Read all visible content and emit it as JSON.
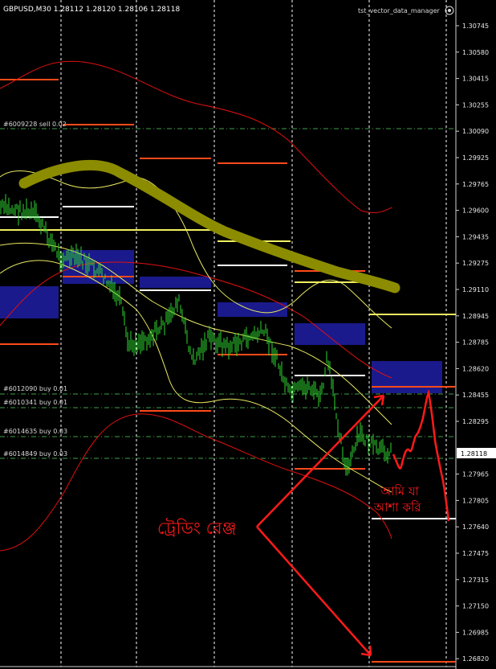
{
  "header": {
    "symbol_info": "GBPUSD,M30  1.28112 1.28120 1.28106 1.28118",
    "indicator_name": "tst_vector_data_manager"
  },
  "colors": {
    "background": "#000000",
    "grid_vertical": "#ffffff",
    "grid_horizontal": "#3fa04a",
    "candle": "#2fd62f",
    "envelope": "#e01010",
    "inner_band": "#e8e860",
    "zone_blue": "#1a1a8c",
    "level_orange": "#ff4a1a",
    "level_white": "#ffffff",
    "level_yellow": "#f0f060",
    "trend_olive": "#8c8c00",
    "annotation_red": "#ff1a1a"
  },
  "price_axis": {
    "ticks": [
      "1.30745",
      "1.30580",
      "1.30415",
      "1.30255",
      "1.30090",
      "1.29925",
      "1.29765",
      "1.29600",
      "1.29435",
      "1.29275",
      "1.29110",
      "1.28945",
      "1.28785",
      "1.28620",
      "1.28455",
      "1.28295",
      "1.28118",
      "1.27965",
      "1.27805",
      "1.27640",
      "1.27475",
      "1.27315",
      "1.27150",
      "1.26985",
      "1.26820"
    ],
    "current_price": "1.28118"
  },
  "orders": [
    {
      "label": "#6009228 sell 0.02",
      "price": 1.3009
    },
    {
      "label": "#6012090 buy 0.01",
      "price": 1.2847
    },
    {
      "label": "#6010341 buy 0.01",
      "price": 1.284
    },
    {
      "label": "#6014635 buy 0.03",
      "price": 1.2822
    },
    {
      "label": "#6014849 buy 0.03",
      "price": 1.2815
    }
  ],
  "annotations": {
    "trading_range": "ট্রেডিং রেঞ্জ",
    "expectation_line1": "আমি যা",
    "expectation_line2": "আশা করি"
  }
}
